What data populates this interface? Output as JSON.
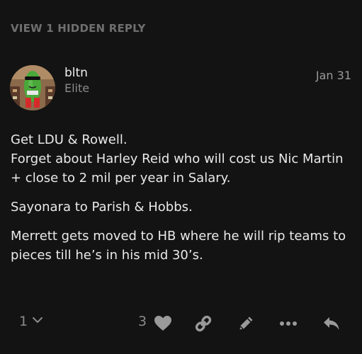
{
  "thread": {
    "hidden_reply_label": "VIEW 1 HIDDEN REPLY"
  },
  "post": {
    "author": {
      "username": "bltn",
      "title": "Elite"
    },
    "date": "Jan 31",
    "paragraphs": [
      [
        "Get LDU & Rowell.",
        "Forget about Harley Reid who will cost us Nic Martin + close to 2 mil per year in Salary."
      ],
      [
        "Sayonara to Parish & Hobbs."
      ],
      [
        "Merrett gets moved to HB where he will rip teams to pieces till he’s in his mid 30’s."
      ]
    ],
    "actions": {
      "reply_count": "1",
      "like_count": "3",
      "icons": [
        "chevron-down-icon",
        "heart-icon",
        "link-icon",
        "pencil-icon",
        "more-icon",
        "reply-icon"
      ]
    }
  },
  "colors": {
    "background": "#131313",
    "text": "#e9e9e9",
    "muted": "#8a8a8a",
    "icon": "#9a9a9a",
    "heart": "#9a9a9a"
  }
}
